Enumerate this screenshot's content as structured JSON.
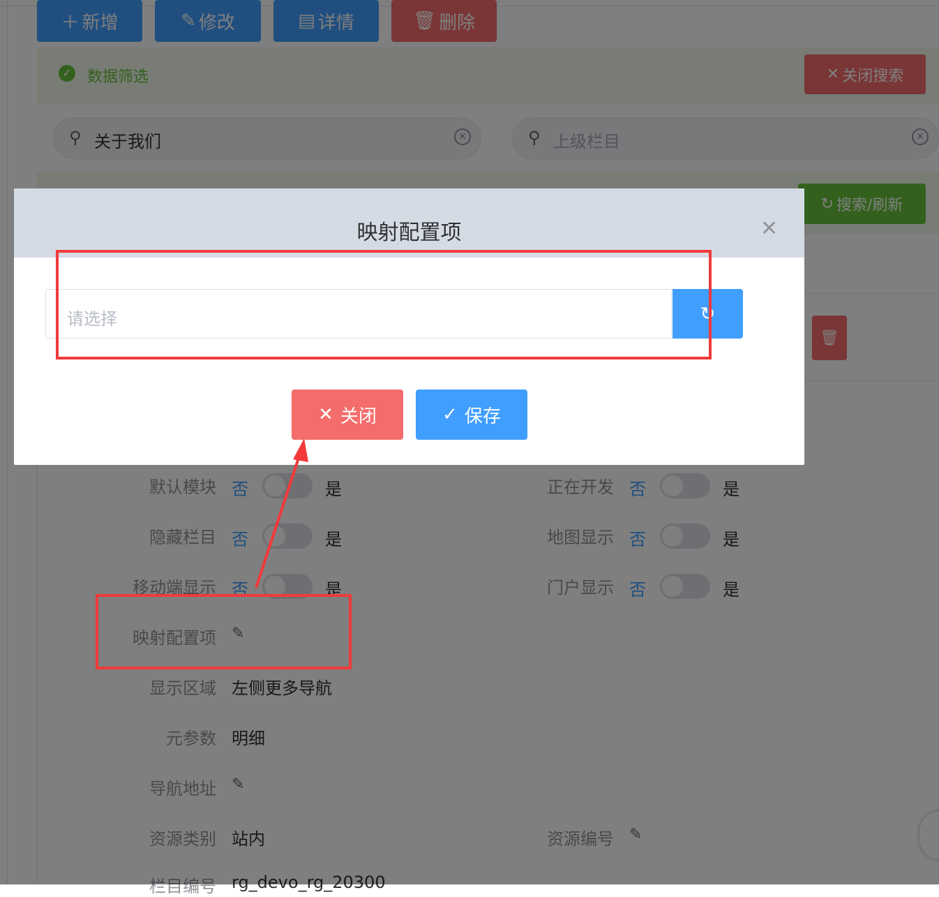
{
  "toolbar": {
    "add": "新增",
    "edit": "修改",
    "detail": "详情",
    "delete": "删除"
  },
  "filter": {
    "title": "数据筛选",
    "close_search": "关闭搜索",
    "search_refresh": "搜索/刷新"
  },
  "search": {
    "keyword_value": "关于我们",
    "parent_placeholder": "上级栏目"
  },
  "form": {
    "yes": "是",
    "no": "否",
    "default_module": "默认模块",
    "in_development": "正在开发",
    "hidden_column": "隐藏栏目",
    "map_display": "地图显示",
    "mobile_display": "移动端显示",
    "portal_display": "门户显示",
    "mapping_config": "映射配置项",
    "display_area_label": "显示区域",
    "display_area_value": "左侧更多导航",
    "meta_param_label": "元参数",
    "meta_param_value": "明细",
    "nav_address_label": "导航地址",
    "resource_type_label": "资源类别",
    "resource_type_value": "站内",
    "resource_no_label": "资源编号",
    "column_no_label": "栏目编号",
    "column_no_value": "rg_devo_rg_20300"
  },
  "dialog": {
    "title": "映射配置项",
    "placeholder": "请选择",
    "close_button": "关闭",
    "save_button": "保存"
  },
  "colors": {
    "primary": "#409eff",
    "danger": "#f56c6c",
    "success": "#67c23a",
    "annotation": "#f23a3a"
  }
}
